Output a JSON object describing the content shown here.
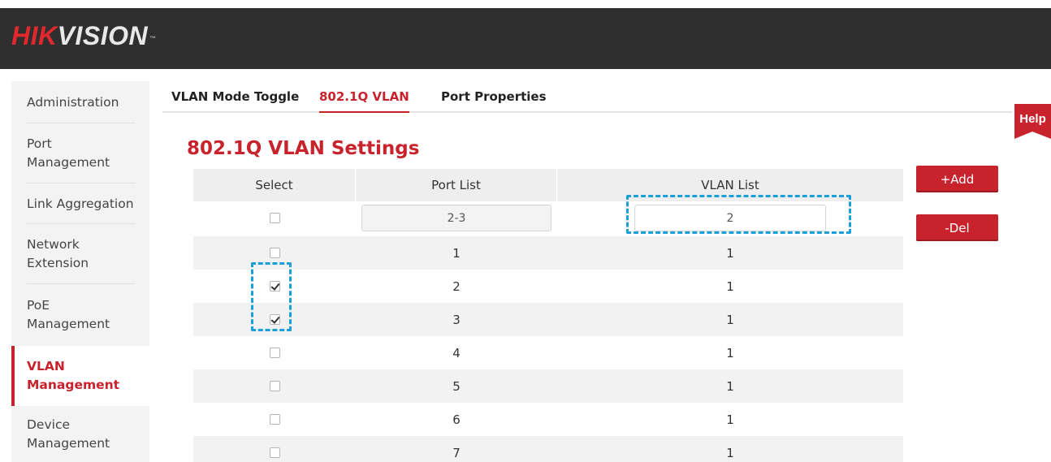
{
  "header": {
    "logo_hik": "HIK",
    "logo_vision": "VISION",
    "logo_tm": "™"
  },
  "sidebar": {
    "items": [
      {
        "label": "Administration"
      },
      {
        "label": "Port Management"
      },
      {
        "label": "Link Aggregation"
      },
      {
        "label": "Network Extension"
      },
      {
        "label": "PoE Management"
      },
      {
        "label": "VLAN Management",
        "active": true
      },
      {
        "label": "Device Management"
      }
    ]
  },
  "tabs": [
    {
      "label": "VLAN Mode Toggle"
    },
    {
      "label": "802.1Q VLAN",
      "active": true
    },
    {
      "label": "Port Properties"
    }
  ],
  "help_label": "Help",
  "page_title": "802.1Q VLAN Settings",
  "table": {
    "headers": [
      "Select",
      "Port List",
      "VLAN List"
    ],
    "input_row": {
      "port_list_value": "2-3",
      "vlan_list_value": "2"
    },
    "rows": [
      {
        "port": "1",
        "vlan": "1",
        "checked": false
      },
      {
        "port": "2",
        "vlan": "1",
        "checked": true
      },
      {
        "port": "3",
        "vlan": "1",
        "checked": true
      },
      {
        "port": "4",
        "vlan": "1",
        "checked": false
      },
      {
        "port": "5",
        "vlan": "1",
        "checked": false
      },
      {
        "port": "6",
        "vlan": "1",
        "checked": false
      },
      {
        "port": "7",
        "vlan": "1",
        "checked": false
      }
    ]
  },
  "buttons": {
    "add_label": "+Add",
    "del_label": "-Del"
  },
  "colors": {
    "brand_red": "#c8232c",
    "header_bg": "#2f2f2f",
    "highlight_blue": "#1aa0d8"
  }
}
